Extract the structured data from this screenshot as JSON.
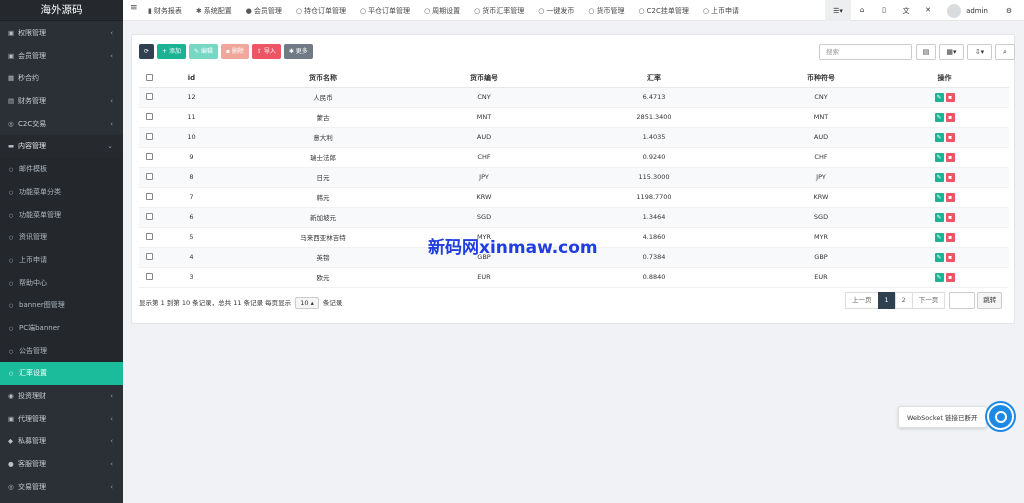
{
  "sidebar": {
    "brand": "海外源码",
    "items": [
      {
        "label": "权限管理",
        "icon": "users-icon",
        "arrow": "‹",
        "cls": "mi",
        "glyph": "▣"
      },
      {
        "label": "会员管理",
        "icon": "user-icon",
        "arrow": "‹",
        "cls": "mi",
        "glyph": "▣"
      },
      {
        "label": "秒合约",
        "icon": "calendar-icon",
        "arrow": "",
        "cls": "mi",
        "glyph": "▦"
      },
      {
        "label": "财务管理",
        "icon": "money-icon",
        "arrow": "‹",
        "cls": "mi",
        "glyph": "▤"
      },
      {
        "label": "C2C交易",
        "icon": "exchange-icon",
        "arrow": "‹",
        "cls": "mi",
        "glyph": "◎"
      },
      {
        "label": "内容管理",
        "icon": "folder-icon",
        "arrow": "⌄",
        "cls": "mi open",
        "glyph": "▬"
      },
      {
        "label": "邮件模板",
        "icon": "circle-icon",
        "arrow": "",
        "cls": "mi sub",
        "glyph": "○"
      },
      {
        "label": "功能菜单分类",
        "icon": "circle-icon",
        "arrow": "",
        "cls": "mi sub",
        "glyph": "○"
      },
      {
        "label": "功能菜单管理",
        "icon": "circle-icon",
        "arrow": "",
        "cls": "mi sub",
        "glyph": "○"
      },
      {
        "label": "资讯管理",
        "icon": "circle-icon",
        "arrow": "",
        "cls": "mi sub",
        "glyph": "○"
      },
      {
        "label": "上币申请",
        "icon": "circle-icon",
        "arrow": "",
        "cls": "mi sub",
        "glyph": "○"
      },
      {
        "label": "帮助中心",
        "icon": "circle-icon",
        "arrow": "",
        "cls": "mi sub",
        "glyph": "○"
      },
      {
        "label": "banner图管理",
        "icon": "circle-icon",
        "arrow": "",
        "cls": "mi sub",
        "glyph": "○"
      },
      {
        "label": "PC端banner",
        "icon": "circle-icon",
        "arrow": "",
        "cls": "mi sub",
        "glyph": "○"
      },
      {
        "label": "公告管理",
        "icon": "circle-icon",
        "arrow": "",
        "cls": "mi sub",
        "glyph": "○"
      },
      {
        "label": "汇率设置",
        "icon": "circle-icon",
        "arrow": "",
        "cls": "mi sub active",
        "glyph": "○"
      },
      {
        "label": "投资理财",
        "icon": "coins-icon",
        "arrow": "‹",
        "cls": "mi",
        "glyph": "◉"
      },
      {
        "label": "代理管理",
        "icon": "agent-icon",
        "arrow": "‹",
        "cls": "mi",
        "glyph": "▣"
      },
      {
        "label": "私募管理",
        "icon": "diamond-icon",
        "arrow": "‹",
        "cls": "mi",
        "glyph": "◆"
      },
      {
        "label": "客服管理",
        "icon": "chat-icon",
        "arrow": "‹",
        "cls": "mi",
        "glyph": "●"
      },
      {
        "label": "交易管理",
        "icon": "eye-icon",
        "arrow": "‹",
        "cls": "mi",
        "glyph": "◎"
      }
    ]
  },
  "topbar": {
    "menu_icon": "≡",
    "nav": [
      "财务报表",
      "系统配置",
      "会员管理",
      "持仓订单管理",
      "平仓订单管理",
      "周期设置",
      "货币汇率管理",
      "一键发币",
      "货币管理",
      "C2C挂单管理",
      "上币申请"
    ],
    "nav_icons": [
      "chart-icon",
      "gear-icon",
      "user-icon",
      "circle-icon",
      "circle-icon",
      "circle-icon",
      "circle-icon",
      "circle-icon",
      "circle-icon",
      "circle-icon",
      "circle-icon"
    ],
    "nav_glyphs": [
      "▮",
      "✱",
      "●",
      "○",
      "○",
      "○",
      "○",
      "○",
      "○",
      "○",
      "○"
    ],
    "right_icons": [
      {
        "name": "home-icon",
        "glyph": "⌂"
      },
      {
        "name": "trash-icon",
        "glyph": "▯"
      },
      {
        "name": "translate-icon",
        "glyph": "文"
      },
      {
        "name": "fullscreen-icon",
        "glyph": "✕"
      }
    ],
    "username": "admin"
  },
  "toolbar": {
    "refresh": "⟳",
    "add": "+ 添加",
    "edit": "✎ 编辑",
    "delete": "▪ 删除",
    "import": "⇪ 导入",
    "more": "✱ 更多"
  },
  "search": {
    "placeholder": "搜索"
  },
  "table": {
    "headers": [
      "id",
      "货币名称",
      "货币编号",
      "汇率",
      "币种符号",
      "操作"
    ],
    "rows": [
      {
        "id": "12",
        "name": "人民币",
        "code": "CNY",
        "rate": "6.4713",
        "symbol": "CNY"
      },
      {
        "id": "11",
        "name": "蒙古",
        "code": "MNT",
        "rate": "2851.3400",
        "symbol": "MNT"
      },
      {
        "id": "10",
        "name": "意大利",
        "code": "AUD",
        "rate": "1.4035",
        "symbol": "AUD"
      },
      {
        "id": "9",
        "name": "瑞士法郎",
        "code": "CHF",
        "rate": "0.9240",
        "symbol": "CHF"
      },
      {
        "id": "8",
        "name": "日元",
        "code": "JPY",
        "rate": "115.3000",
        "symbol": "JPY"
      },
      {
        "id": "7",
        "name": "韩元",
        "code": "KRW",
        "rate": "1198.7700",
        "symbol": "KRW"
      },
      {
        "id": "6",
        "name": "新加坡元",
        "code": "SGD",
        "rate": "1.3464",
        "symbol": "SGD"
      },
      {
        "id": "5",
        "name": "马来西亚林吉特",
        "code": "MYR",
        "rate": "4.1860",
        "symbol": "MYR"
      },
      {
        "id": "4",
        "name": "英镑",
        "code": "GBP",
        "rate": "0.7384",
        "symbol": "GBP"
      },
      {
        "id": "3",
        "name": "欧元",
        "code": "EUR",
        "rate": "0.8840",
        "symbol": "EUR"
      }
    ]
  },
  "pagination": {
    "info_before": "显示第 1 到第 10 条记录，总共 11 条记录 每页显示",
    "page_size": "10",
    "info_after": "条记录",
    "prev": "上一页",
    "pages": [
      "1",
      "2"
    ],
    "next": "下一页",
    "jump": "跳转"
  },
  "watermark": "新码网xinmaw.com",
  "websocket": {
    "text": "WebSocket 链接已断开"
  },
  "colors": {
    "accent": "#1abc9c",
    "sidebar": "#2b3036",
    "danger": "#ed5565"
  }
}
